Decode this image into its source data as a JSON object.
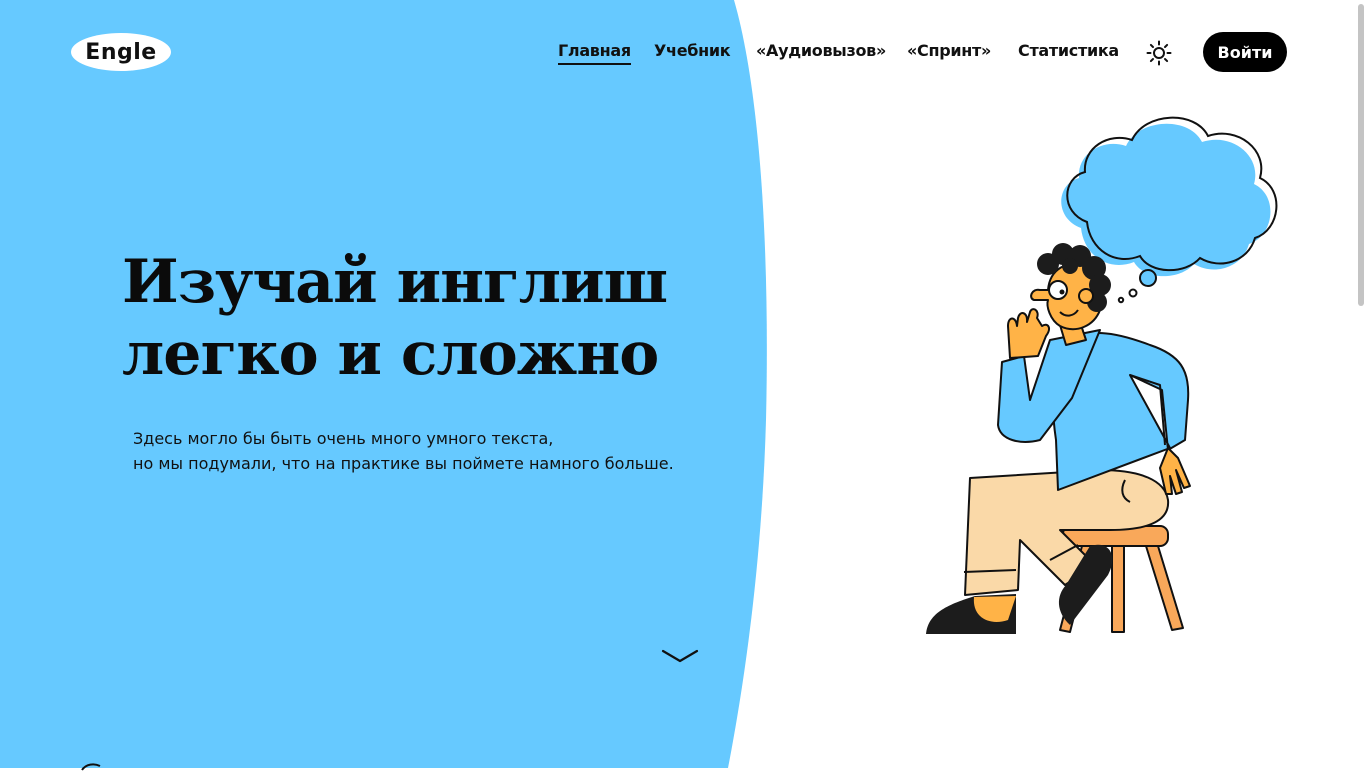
{
  "colors": {
    "accent_blue": "#66c9ff",
    "text_dark": "#0b0b0b",
    "button_bg": "#000000",
    "skin": "#ffb347",
    "pants": "#fad9a8",
    "stool": "#f9a85a"
  },
  "header": {
    "logo_text": "Engle",
    "nav": [
      {
        "label": "Главная",
        "active": true
      },
      {
        "label": "Учебник",
        "active": false
      },
      {
        "label": "«Аудиовызов»",
        "active": false
      },
      {
        "label": "«Спринт»",
        "active": false
      },
      {
        "label": "Статистика",
        "active": false
      }
    ],
    "theme_icon": "sun-icon",
    "login_label": "Войти"
  },
  "hero": {
    "title_lines": [
      "Изучай инглиш",
      "легко и сложно"
    ],
    "text_lines": [
      "Здесь могло бы быть очень много умного текста,",
      "но мы подумали, что на практике вы поймете намного больше."
    ],
    "scroll_icon": "chevron-down-icon"
  },
  "illustration": {
    "name": "thinking-person-on-stool"
  }
}
